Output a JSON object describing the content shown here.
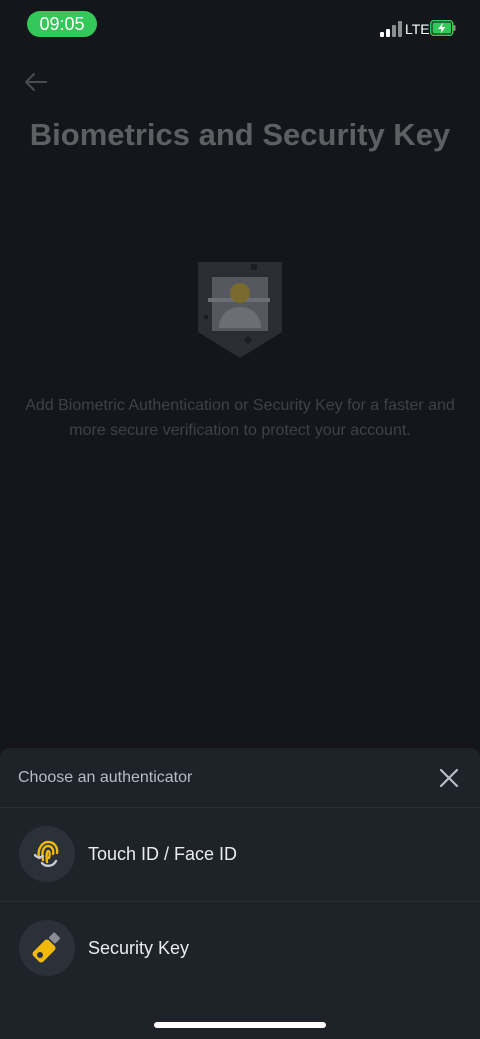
{
  "status_bar": {
    "time": "09:05",
    "network": "LTE",
    "signal_bars": 2,
    "signal_bars_total": 4,
    "battery_charging": true,
    "colors": {
      "time_pill": "#34c759",
      "battery": "#34c759"
    }
  },
  "page": {
    "back_icon": "arrow-left-icon",
    "title": "Biometrics and Security Key",
    "illustration_icon": "shield-portrait-icon",
    "description": "Add Biometric Authentication or Security Key for a faster and more secure verification to protect your account."
  },
  "sheet": {
    "title": "Choose an authenticator",
    "close_icon": "close-icon",
    "options": [
      {
        "label": "Touch ID / Face ID",
        "icon": "fingerprint-icon"
      },
      {
        "label": "Security Key",
        "icon": "usb-key-icon"
      }
    ]
  },
  "colors": {
    "accent": "#f0b90b",
    "background": "#14161b",
    "sheet": "#1e2229"
  }
}
